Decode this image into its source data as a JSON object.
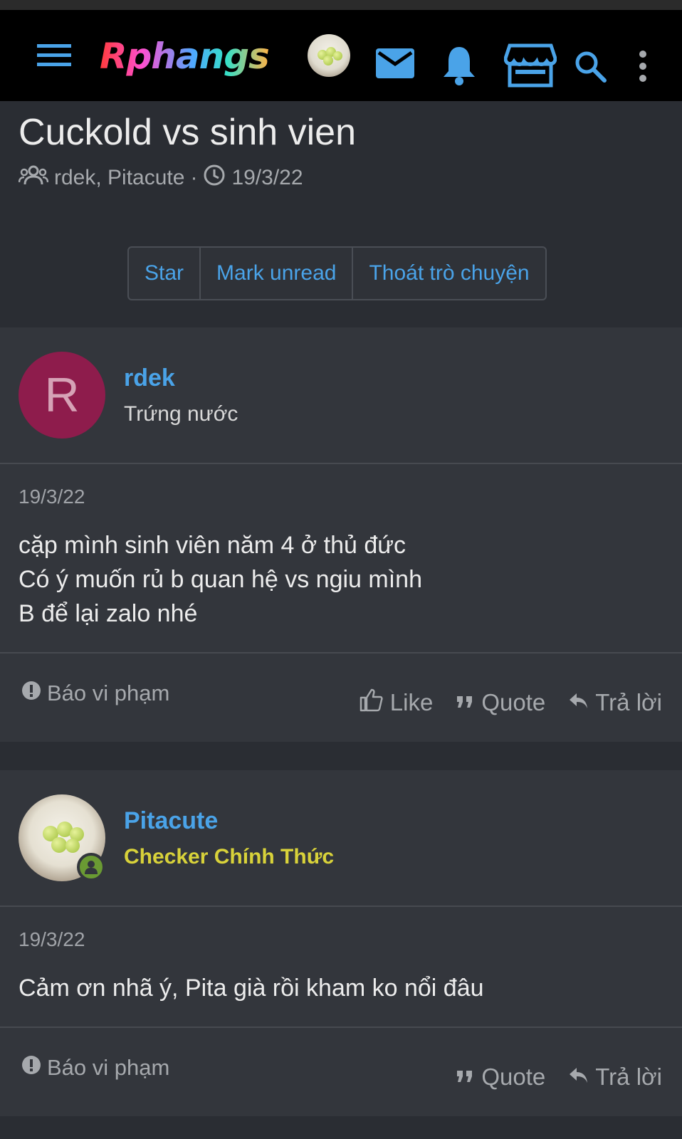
{
  "navbar": {
    "logo_text": "Rphangs",
    "icons": [
      "menu-icon",
      "avatar",
      "mail-icon",
      "bell-icon",
      "store-icon",
      "search-icon",
      "more-icon"
    ],
    "accent_color": "#4aa3e8"
  },
  "thread": {
    "title": "Cuckold vs sinh vien",
    "participants": "rdek, Pitacute",
    "separator": "·",
    "date": "19/3/22",
    "buttons": {
      "star": "Star",
      "mark_unread": "Mark unread",
      "leave": "Thoát trò chuyện"
    }
  },
  "posts": [
    {
      "username": "rdek",
      "avatar_letter": "R",
      "user_title": "Trứng nước",
      "date": "19/3/22",
      "lines": [
        "cặp mình sinh viên năm 4 ở thủ đức",
        "Có ý muốn rủ b quan hệ vs ngiu mình",
        "B để lại zalo nhé"
      ],
      "report": "Báo vi phạm",
      "like": "Like",
      "quote": "Quote",
      "reply": "Trả lời"
    },
    {
      "username": "Pitacute",
      "user_title": "Checker Chính Thức",
      "date": "19/3/22",
      "lines": [
        "Cảm ơn nhã ý, Pita già rồi kham ko nổi đâu"
      ],
      "report": "Báo vi phạm",
      "quote": "Quote",
      "reply": "Trả lời"
    }
  ]
}
